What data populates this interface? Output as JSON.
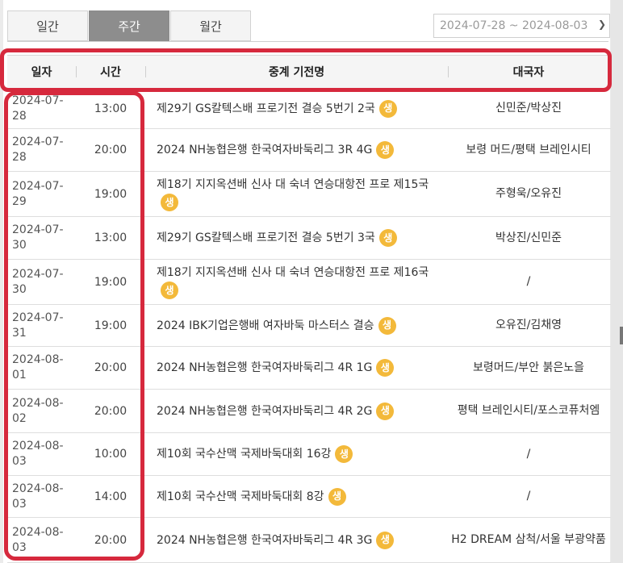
{
  "tabs": [
    {
      "label": "일간",
      "active": false
    },
    {
      "label": "주간",
      "active": true
    },
    {
      "label": "월간",
      "active": false
    }
  ],
  "date_range": "2024-07-28 ~ 2024-08-03",
  "columns": {
    "date": "일자",
    "time": "시간",
    "name": "중계 기전명",
    "players": "대국자"
  },
  "live_badge": "생",
  "rows": [
    {
      "date": "2024-07-28",
      "time": "13:00",
      "name": "제29기 GS칼텍스배 프로기전 결승 5번기 2국",
      "players": "신민준/박상진"
    },
    {
      "date": "2024-07-28",
      "time": "20:00",
      "name": "2024 NH농협은행 한국여자바둑리그 3R 4G",
      "players": "보령 머드/평택 브레인시티"
    },
    {
      "date": "2024-07-29",
      "time": "19:00",
      "name": "제18기 지지옥션배 신사 대 숙녀 연승대항전 프로 제15국",
      "players": "주형욱/오유진"
    },
    {
      "date": "2024-07-30",
      "time": "13:00",
      "name": "제29기 GS칼텍스배 프로기전 결승 5번기 3국",
      "players": "박상진/신민준"
    },
    {
      "date": "2024-07-30",
      "time": "19:00",
      "name": "제18기 지지옥션배 신사 대 숙녀 연승대항전 프로 제16국",
      "players": "/"
    },
    {
      "date": "2024-07-31",
      "time": "19:00",
      "name": "2024 IBK기업은행배 여자바둑 마스터스 결승",
      "players": "오유진/김채영"
    },
    {
      "date": "2024-08-01",
      "time": "20:00",
      "name": "2024 NH농협은행 한국여자바둑리그 4R 1G",
      "players": "보령머드/부안 붉은노을"
    },
    {
      "date": "2024-08-02",
      "time": "20:00",
      "name": "2024 NH농협은행 한국여자바둑리그 4R 2G",
      "players": "평택 브레인시티/포스코퓨처엠"
    },
    {
      "date": "2024-08-03",
      "time": "10:00",
      "name": "제10회 국수산맥 국제바둑대회 16강",
      "players": "/"
    },
    {
      "date": "2024-08-03",
      "time": "14:00",
      "name": "제10회 국수산맥 국제바둑대회 8강",
      "players": "/"
    },
    {
      "date": "2024-08-03",
      "time": "20:00",
      "name": "2024 NH농협은행 한국여자바둑리그 4R 3G",
      "players": "H2 DREAM 삼척/서울 부광약품"
    }
  ],
  "colors": {
    "highlight": "#d6293d",
    "live_badge": "#f3b93a",
    "active_tab": "#8d8d8d"
  }
}
